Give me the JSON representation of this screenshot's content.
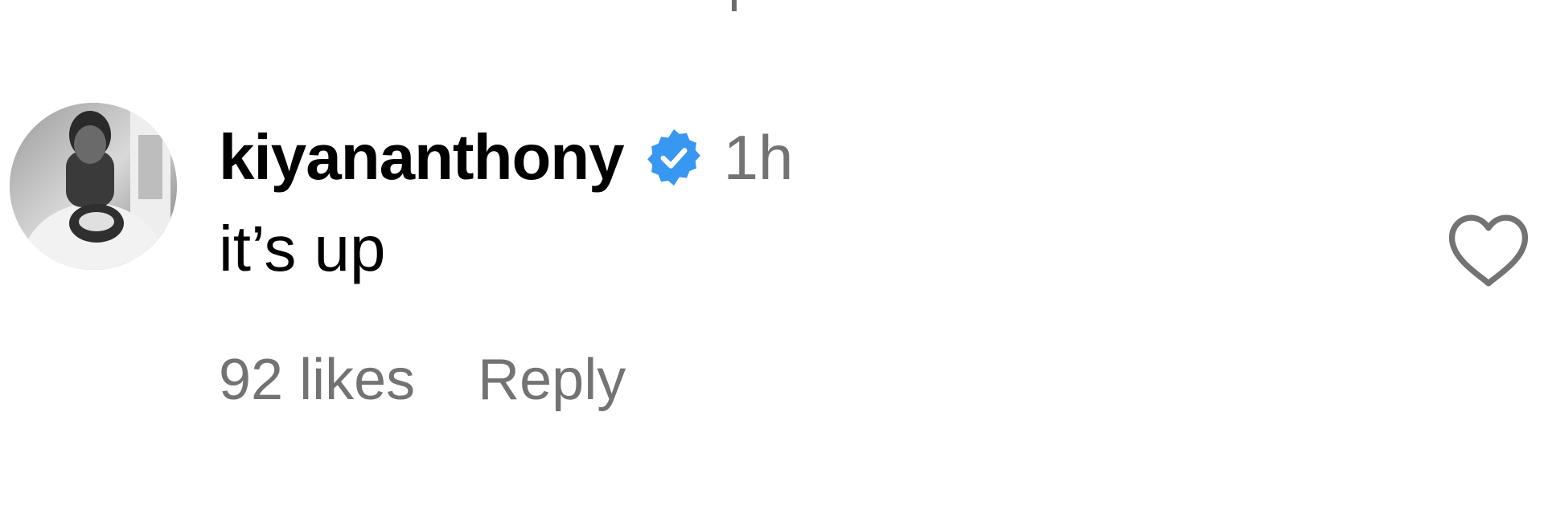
{
  "comment": {
    "username": "kiyananthony",
    "verified": true,
    "timestamp": "1h",
    "text": "it’s up",
    "likes": "92 likes",
    "reply_label": "Reply"
  },
  "colors": {
    "verified_badge": "#3897f0",
    "muted_text": "#737373",
    "primary_text": "#000000"
  },
  "icons": {
    "verified": "verified-badge-icon",
    "like": "heart-outline-icon"
  }
}
